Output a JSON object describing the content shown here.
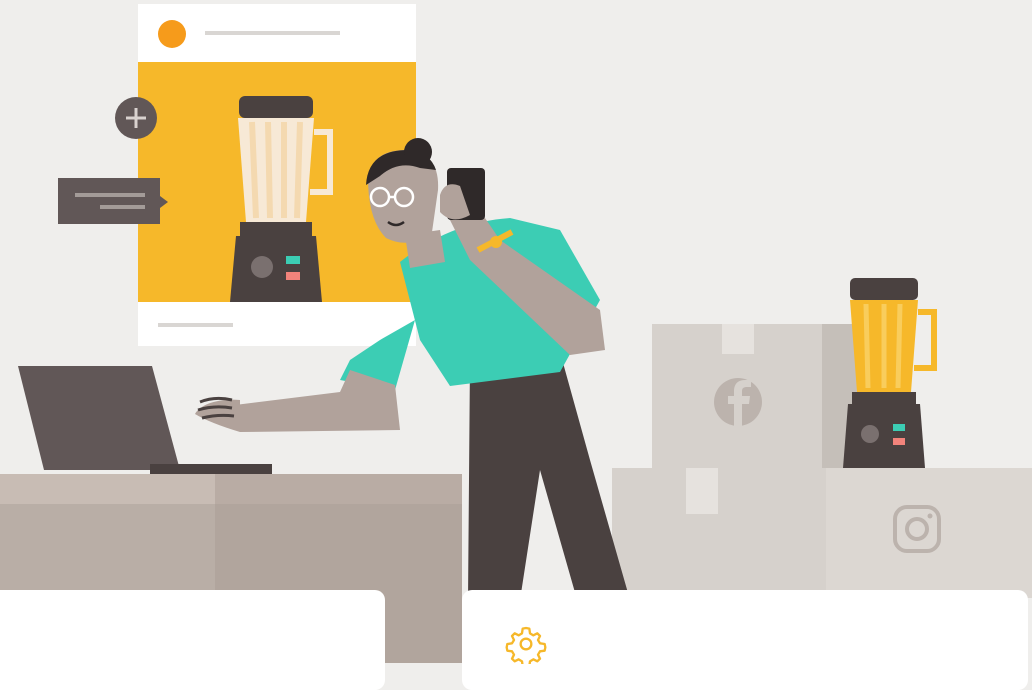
{
  "colors": {
    "background": "#efeeec",
    "accent_yellow": "#f6b82a",
    "teal": "#3ccdb4",
    "dark_brown": "#4a4140",
    "desk": "#b9aea6",
    "box": "#d6d1cc"
  },
  "illustration": {
    "post_card": {
      "avatar_color": "#f69b1b",
      "product": "blender"
    },
    "icons": [
      "plus-icon",
      "comment-bubble-icon",
      "facebook-icon",
      "instagram-icon",
      "phone-icon",
      "laptop-icon"
    ]
  },
  "cards": [
    {
      "name": "left-card"
    },
    {
      "name": "settings-card",
      "icon": "gear-icon"
    }
  ]
}
